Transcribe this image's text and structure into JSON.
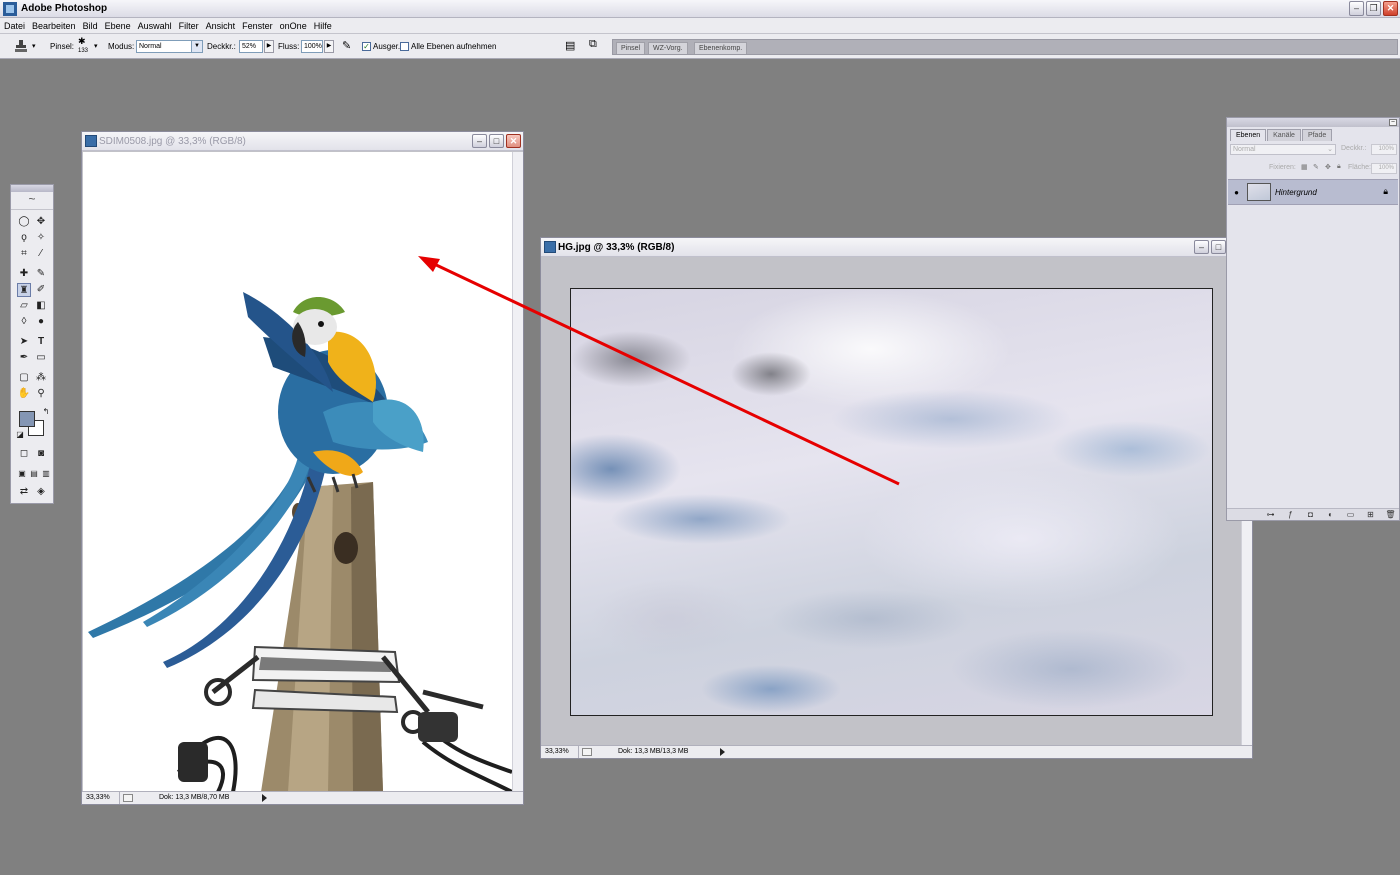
{
  "app": {
    "title": "Adobe Photoshop"
  },
  "menu": [
    "Datei",
    "Bearbeiten",
    "Bild",
    "Ebene",
    "Auswahl",
    "Filter",
    "Ansicht",
    "Fenster",
    "onOne",
    "Hilfe"
  ],
  "options": {
    "brush_label": "Pinsel:",
    "brush_size": "133",
    "mode_label": "Modus:",
    "mode_value": "Normal",
    "opacity_label": "Deckkr.:",
    "opacity_value": "52%",
    "flow_label": "Fluss:",
    "flow_value": "100%",
    "aligned_label": "Ausger.",
    "aligned_checked": true,
    "all_layers_label": "Alle Ebenen aufnehmen",
    "all_layers_checked": false,
    "palette_well_tabs": [
      "Pinsel",
      "WZ-Vorg.",
      "Ebenenkomp."
    ]
  },
  "doc1": {
    "title": "SDIM0508.jpg @ 33,3% (RGB/8)",
    "zoom": "33,33%",
    "doc_size": "Dok: 13,3 MB/8,70 MB"
  },
  "doc2": {
    "title": "HG.jpg @ 33,3% (RGB/8)",
    "zoom": "33,33%",
    "doc_size": "Dok: 13,3 MB/13,3 MB"
  },
  "layers_panel": {
    "tabs": [
      "Ebenen",
      "Kanäle",
      "Pfade"
    ],
    "blend_mode": "Normal",
    "opacity_label": "Deckkr.:",
    "opacity_value": "100%",
    "lock_label": "Fixieren:",
    "fill_label": "Fläche:",
    "fill_value": "100%",
    "layers": [
      {
        "name": "Hintergrund",
        "visible": true,
        "locked": true
      }
    ]
  },
  "colors": {
    "foreground": "#8496b4",
    "background": "#ffffff",
    "annotation_arrow": "#e60000"
  }
}
